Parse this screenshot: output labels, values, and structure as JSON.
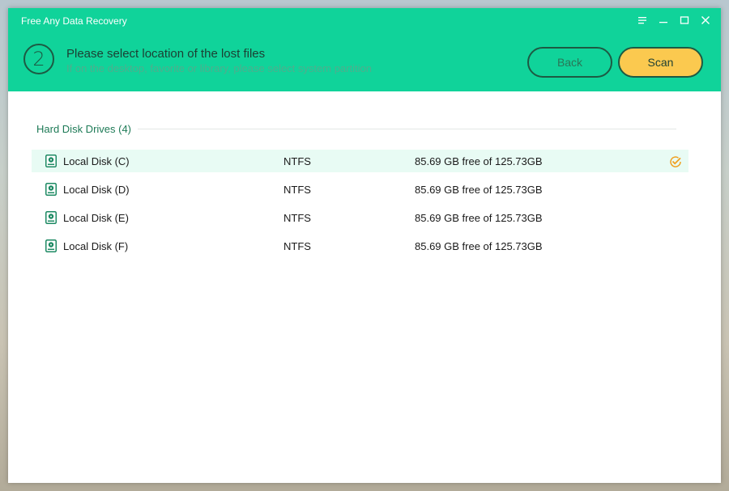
{
  "app": {
    "title": "Free Any Data Recovery"
  },
  "window_controls": [
    {
      "name": "menu-icon"
    },
    {
      "name": "minimize-icon"
    },
    {
      "name": "maximize-icon"
    },
    {
      "name": "close-icon"
    }
  ],
  "step": {
    "number": "2",
    "title": "Please select location of the lost files",
    "subtitle": "If on the desktop, favorite or library, please select system partition"
  },
  "buttons": {
    "back": "Back",
    "scan": "Scan"
  },
  "section": {
    "title": "Hard Disk Drives (4)"
  },
  "drives": [
    {
      "name": "Local Disk (C)",
      "fs": "NTFS",
      "space": "85.69 GB free of 125.73GB",
      "selected": true
    },
    {
      "name": "Local Disk (D)",
      "fs": "NTFS",
      "space": "85.69 GB free of 125.73GB",
      "selected": false
    },
    {
      "name": "Local Disk (E)",
      "fs": "NTFS",
      "space": "85.69 GB free of 125.73GB",
      "selected": false
    },
    {
      "name": "Local Disk (F)",
      "fs": "NTFS",
      "space": "85.69 GB free of 125.73GB",
      "selected": false
    }
  ],
  "colors": {
    "header_bg": "#10d39a",
    "accent_dark": "#1d5a43",
    "scan_button": "#fbc94f",
    "selected_row": "#e8fbf4",
    "check": "#f0a020"
  }
}
